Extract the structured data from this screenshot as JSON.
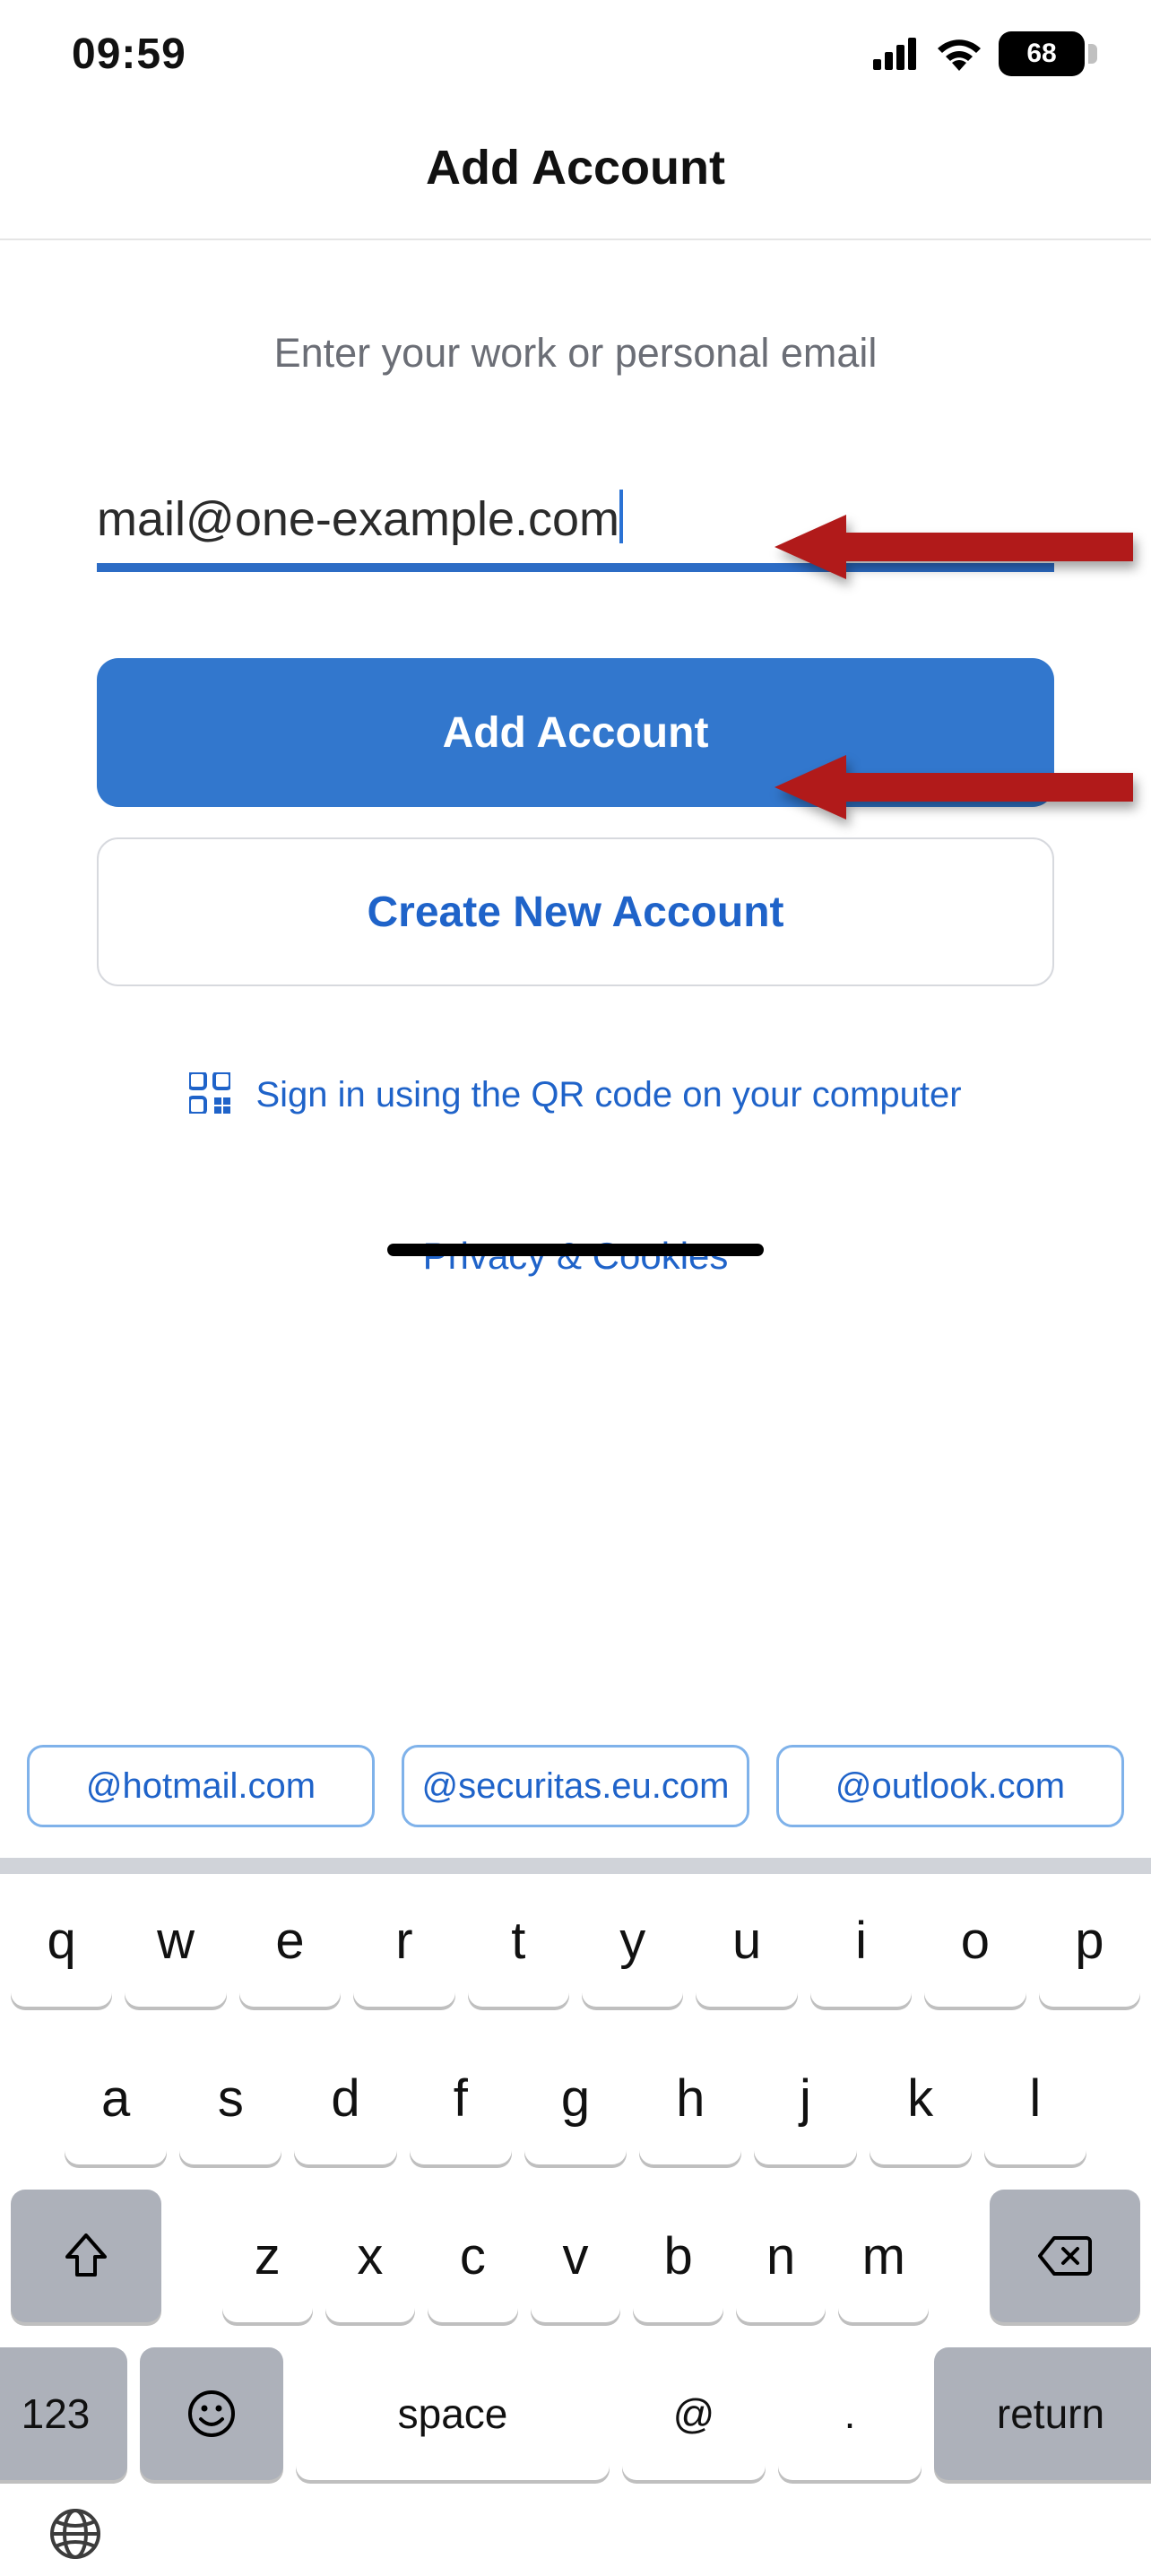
{
  "status": {
    "time": "09:59",
    "battery_percent": "68"
  },
  "header": {
    "title": "Add Account"
  },
  "form": {
    "prompt": "Enter your work or personal email",
    "email_value": "mail@one-example.com",
    "add_account_label": "Add Account",
    "create_account_label": "Create New Account",
    "qr_label": "Sign in using the QR code on your computer",
    "privacy_label": "Privacy & Cookies"
  },
  "suggestions": [
    "@hotmail.com",
    "@securitas.eu.com",
    "@outlook.com"
  ],
  "keyboard": {
    "row1": [
      "q",
      "w",
      "e",
      "r",
      "t",
      "y",
      "u",
      "i",
      "o",
      "p"
    ],
    "row2": [
      "a",
      "s",
      "d",
      "f",
      "g",
      "h",
      "j",
      "k",
      "l"
    ],
    "row3": [
      "z",
      "x",
      "c",
      "v",
      "b",
      "n",
      "m"
    ],
    "numbers_label": "123",
    "space_label": "space",
    "at_label": "@",
    "dot_label": ".",
    "return_label": "return"
  }
}
